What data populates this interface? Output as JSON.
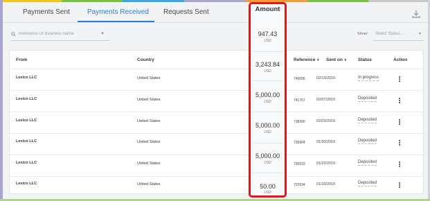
{
  "tabs": [
    {
      "label": "Payments Sent",
      "active": false
    },
    {
      "label": "Payments Received",
      "active": true
    },
    {
      "label": "Requests Sent",
      "active": false
    }
  ],
  "filters": {
    "search_placeholder": "Reference Or Business Name",
    "show_label": "Show:",
    "status_placeholder": "Select Status..."
  },
  "table": {
    "headers": {
      "from": "From",
      "country": "Country",
      "amount": "Amount",
      "reference": "Reference",
      "sent_on": "Sent on",
      "status": "Status",
      "action": "Action"
    },
    "rows": [
      {
        "from": "Lexico LLC",
        "country": "United States",
        "amount": "947.43",
        "currency": "USD",
        "reference": "746095",
        "sent_on": "02/13/2019",
        "status": "In progress"
      },
      {
        "from": "Lexico LLC",
        "country": "United States",
        "amount": "3,243.84",
        "currency": "USD",
        "reference": "741757",
        "sent_on": "02/07/2019",
        "status": "Deposited"
      },
      {
        "from": "Lexico LLC",
        "country": "United States",
        "amount": "5,000.00",
        "currency": "USD",
        "reference": "738390",
        "sent_on": "02/03/2019",
        "status": "Deposited"
      },
      {
        "from": "Lexico LLC",
        "country": "United States",
        "amount": "5,000.00",
        "currency": "USD",
        "reference": "735904",
        "sent_on": "01/30/2019",
        "status": "Deposited"
      },
      {
        "from": "Lexico LLC",
        "country": "United States",
        "amount": "5,000.00",
        "currency": "USD",
        "reference": "730633",
        "sent_on": "01/22/2019",
        "status": "Deposited"
      },
      {
        "from": "Lexico LLC",
        "country": "United States",
        "amount": "50.00",
        "currency": "USD",
        "reference": "722634",
        "sent_on": "01/10/2019",
        "status": "Deposited"
      }
    ]
  },
  "icons": {
    "download": "download-icon",
    "search": "search-icon",
    "dropdown": "chevron-down-icon",
    "row_action": "kebab-menu-icon",
    "sort": "sort-icon"
  },
  "colors": {
    "accent": "#2b7fd1",
    "highlight_border": "#e0161b",
    "page_background": "#f2f3f5"
  }
}
